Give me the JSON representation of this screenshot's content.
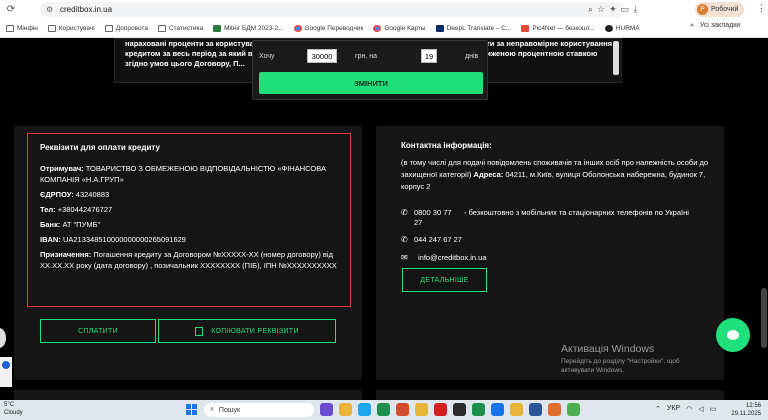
{
  "browser": {
    "url": "creditbox.in.ua",
    "profile_label": "Робочий",
    "profile_initial": "Р",
    "bookmarks": [
      "Мінфін",
      "Користувачі",
      "Допровота",
      "Статистика",
      "Mitнiг БДМ 2023-2...",
      "Google Переводчик",
      "Google Карты",
      "DeepL Translate – С...",
      "Pic4Net — безкошт...",
      "HURMA"
    ],
    "bookmarks_more": "»",
    "all_bookmarks": "Усі закладки"
  },
  "terms": {
    "text": "нараховані проценти за користування кредитом згідно з умовами цього Договору та/або проценти за неправомірне користування кредитом за весь період за який вони були нараховані відповідно до умов цього Договору за зниженою процентною ставкою згідно умов цього Договору, П..."
  },
  "calculator": {
    "want_label": "Хочу",
    "amount_value": "30000",
    "currency_label": "грн, на",
    "days_value": "19",
    "days_label": "днів",
    "change_button": "ЗМІНИТИ"
  },
  "requisites": {
    "title": "Реквізити для оплати кредиту",
    "recipient_label": "Отримувач:",
    "recipient_value": "ТОВАРИСТВО З ОБМЕЖЕНОЮ ВІДПОВІДАЛЬНІСТЮ «ФІНАНСОВА КОМПАНІЯ «Н.А.ГРУП»",
    "edrpou_label": "ЄДРПОУ:",
    "edrpou_value": "43240883",
    "phone_label": "Тел:",
    "phone_value": "+380442476727",
    "bank_label": "Банк:",
    "bank_value": "АТ \"ПУМБ\"",
    "iban_label": "IBAN:",
    "iban_value": "UA213348510000000000265091629",
    "purpose_label": "Призначення:",
    "purpose_value": "Погашення кредиту за Договором №ХХХХХ-ХХ (номер договору) від ХХ.ХХ.ХХ року (дата договору) , позичальник ХХХХХХХХ (ПІБ), ІПН №ХХХХХХХХХХ",
    "pay_button": "СПЛАТИТИ",
    "copy_button": "КОПІЮВАТИ РЕКВІЗИТИ"
  },
  "contacts": {
    "title": "Контактна інформація:",
    "intro": "(в тому числі для подачі повідомлень споживачів та інших осіб про належність особи до захищеної категорії)",
    "address_label": "Адреса:",
    "address_value": "04211, м.Київ, вулиця Оболонська набережна, будинок 7, корпус 2",
    "tollfree_phone": "0800 30 77 27",
    "tollfree_note": "- безкоштовно з мобільних та стаціонарних телефонів по Україні",
    "phone": "044 247 67 27",
    "email": "info@creditbox.in.ua",
    "details_button": "ДЕТАЛЬНІШЕ"
  },
  "watermark": {
    "title": "Активація Windows",
    "subtitle": "Перейдіть до розділу \"Настройки\", щоб активувати Windows."
  },
  "taskbar": {
    "weather_temp": "5°C",
    "weather_desc": "Cloudy",
    "search_placeholder": "Пошук",
    "language": "УКР",
    "time": "12:56",
    "date": "29.11.2025"
  }
}
